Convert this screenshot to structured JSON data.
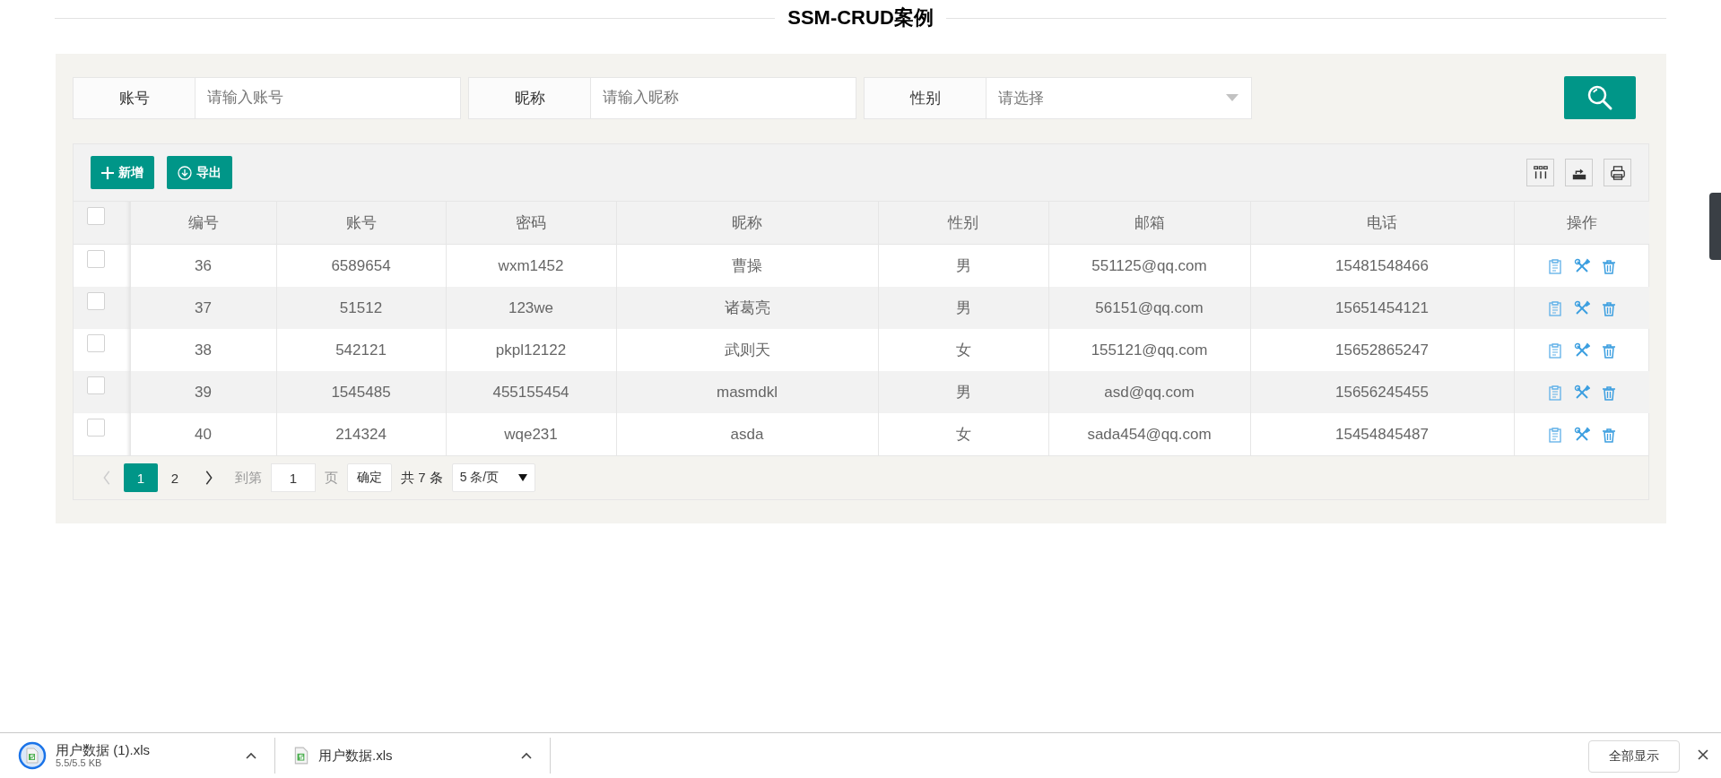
{
  "title": "SSM-CRUD案例",
  "search": {
    "fields": [
      {
        "label": "账号",
        "placeholder": "请输入账号",
        "kind": "text"
      },
      {
        "label": "昵称",
        "placeholder": "请输入昵称",
        "kind": "text"
      },
      {
        "label": "性别",
        "placeholder": "请选择",
        "kind": "select"
      }
    ]
  },
  "toolbar": {
    "buttons": [
      {
        "label": "新增",
        "kind": "add"
      },
      {
        "label": "导出",
        "kind": "export"
      }
    ]
  },
  "table": {
    "select_all_checked": false,
    "columns": [
      "编号",
      "账号",
      "密码",
      "昵称",
      "性别",
      "邮箱",
      "电话",
      "操作"
    ],
    "rows": [
      {
        "checked": false,
        "cells": [
          "36",
          "6589654",
          "wxm1452",
          "曹操",
          "男",
          "551125@qq.com",
          "15481548466"
        ]
      },
      {
        "checked": false,
        "cells": [
          "37",
          "51512",
          "123we",
          "诸葛亮",
          "男",
          "56151@qq.com",
          "15651454121"
        ]
      },
      {
        "checked": false,
        "cells": [
          "38",
          "542121",
          "pkpl12122",
          "武则天",
          "女",
          "155121@qq.com",
          "15652865247"
        ]
      },
      {
        "checked": false,
        "cells": [
          "39",
          "1545485",
          "455155454",
          "masmdkl",
          "男",
          "asd@qq.com",
          "15656245455"
        ]
      },
      {
        "checked": false,
        "cells": [
          "40",
          "214324",
          "wqe231",
          "asda",
          "女",
          "sada454@qq.com",
          "15454845487"
        ]
      }
    ]
  },
  "pagination": {
    "pages": [
      {
        "label": "1",
        "selected": true
      },
      {
        "label": "2",
        "selected": false
      }
    ],
    "goto_label": "到第",
    "goto_value": "1",
    "page_unit": "页",
    "confirm": "确定",
    "total": "共 7 条",
    "page_size": "5 条/页"
  },
  "downloads": {
    "items": [
      {
        "name": "用户数据 (1).xls",
        "detail": "5.5/5.5 KB",
        "kind": "progress"
      },
      {
        "name": "用户数据.xls",
        "kind": "file"
      }
    ],
    "show_all": "全部显示"
  }
}
